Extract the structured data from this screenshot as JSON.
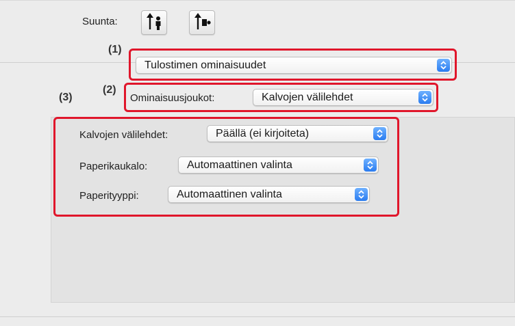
{
  "orientation": {
    "label": "Suunta:",
    "buttons": [
      {
        "name": "portrait",
        "icon": "portrait-orientation-icon"
      },
      {
        "name": "landscape",
        "icon": "landscape-orientation-icon"
      }
    ]
  },
  "callouts": {
    "c1": "(1)",
    "c2": "(2)",
    "c3": "(3)"
  },
  "printer_features_menu": {
    "value": "Tulostimen ominaisuudet"
  },
  "feature_sets": {
    "label": "Ominaisuusjoukot:",
    "value": "Kalvojen välilehdet"
  },
  "transparency_settings": {
    "tabs": {
      "label": "Kalvojen välilehdet:",
      "value": "Päällä (ei kirjoiteta)"
    },
    "tray": {
      "label": "Paperikaukalo:",
      "value": "Automaattinen valinta"
    },
    "type": {
      "label": "Paperityyppi:",
      "value": "Automaattinen valinta"
    }
  },
  "colors": {
    "highlight": "#e0162b",
    "popup_accent": "#2a7cf0"
  }
}
